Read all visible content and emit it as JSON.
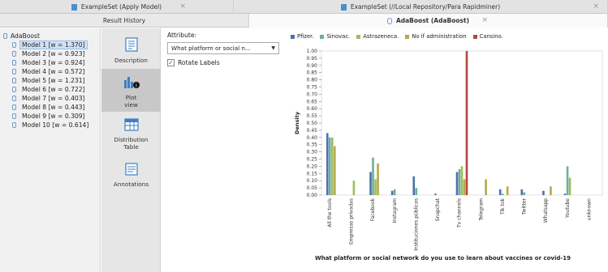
{
  "tabs_top": [
    {
      "label": "ExampleSet (Apply Model)"
    },
    {
      "label": "ExampleSet (//Local Repository/Para Rapidminer)"
    }
  ],
  "tabs_second": [
    {
      "label": "Result History"
    },
    {
      "label": "AdaBoost (AdaBoost)"
    }
  ],
  "close_glyph": "×",
  "tree": {
    "root": "AdaBoost",
    "items": [
      "Model 1 [w = 1.370]",
      "Model 2 [w = 0.923]",
      "Model 3 [w = 0.924]",
      "Model 4 [w = 0.572]",
      "Model 5 [w = 1.231]",
      "Model 6 [w = 0.722]",
      "Model 7 [w = 0.403]",
      "Model 8 [w = 0.443]",
      "Model 9 [w = 0.309]",
      "Model 10 [w = 0.614]"
    ],
    "selected_index": 0
  },
  "views": {
    "description": "Description",
    "plot_line1": "Plot",
    "plot_line2": "view",
    "distribution_line1": "Distribution",
    "distribution_line2": "Table",
    "annotations": "Annotations"
  },
  "controls": {
    "attribute_label": "Attribute:",
    "attribute_value": "What platform or social n...",
    "rotate_labels": "Rotate Labels",
    "rotate_checked": true,
    "check_glyph": "✓",
    "caret_glyph": "▼"
  },
  "colors": {
    "accent": "#4a8fd1",
    "selected_bg": "#cfe1f5"
  },
  "chart_data": {
    "type": "bar",
    "xlabel": "What platform or social network do you use to learn about vaccines or covid-19",
    "ylabel": "Density",
    "ylim": [
      0,
      1.0
    ],
    "yticks": [
      0.0,
      0.05,
      0.1,
      0.15,
      0.2,
      0.25,
      0.3,
      0.35,
      0.4,
      0.45,
      0.5,
      0.55,
      0.6,
      0.65,
      0.7,
      0.75,
      0.8,
      0.85,
      0.9,
      0.95,
      1.0
    ],
    "ytick_labels": [
      "0.00",
      "0.05",
      "0.10",
      "0.15",
      "0.20",
      "0.25",
      "0.30",
      "0.35",
      "0.40",
      "0.45",
      "0.50",
      "0.55",
      "0.60",
      "0.65",
      "0.70",
      "0.75",
      "0.80",
      "0.85",
      "0.90",
      "0.95",
      "1.00"
    ],
    "categories": [
      "All the tools",
      "Empresas privadas",
      "Facebook",
      "Instagram",
      "Instituciones públicas",
      "Snapchat",
      "Tv channels",
      "Telegram",
      "Tik tok",
      "Twitter",
      "Whatsapp",
      "Youtube",
      "unknown"
    ],
    "series": [
      {
        "name": "Pfizer.",
        "color": "#4c72a8",
        "values": [
          0.43,
          0.0,
          0.16,
          0.03,
          0.13,
          0.01,
          0.16,
          0.0,
          0.04,
          0.04,
          0.03,
          0.01,
          0.0
        ]
      },
      {
        "name": "Sinovac.",
        "color": "#6fae9a",
        "values": [
          0.4,
          0.0,
          0.26,
          0.04,
          0.05,
          0.0,
          0.18,
          0.0,
          0.01,
          0.02,
          0.0,
          0.2,
          0.0
        ]
      },
      {
        "name": "Astrazeneca.",
        "color": "#9bbf5a",
        "values": [
          0.4,
          0.1,
          0.11,
          0.0,
          0.0,
          0.0,
          0.2,
          0.0,
          0.0,
          0.0,
          0.0,
          0.12,
          0.0
        ]
      },
      {
        "name": "No if administration",
        "color": "#b7a94c",
        "values": [
          0.34,
          0.0,
          0.22,
          0.0,
          0.0,
          0.0,
          0.11,
          0.11,
          0.06,
          0.0,
          0.06,
          0.0,
          0.0
        ]
      },
      {
        "name": "Cansino.",
        "color": "#b5473f",
        "values": [
          0.0,
          0.0,
          0.0,
          0.0,
          0.0,
          0.0,
          1.0,
          0.0,
          0.0,
          0.0,
          0.0,
          0.0,
          0.0
        ]
      }
    ]
  }
}
